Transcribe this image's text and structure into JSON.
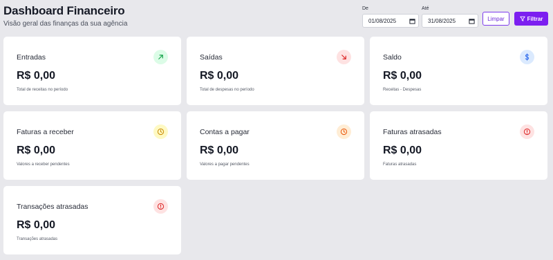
{
  "header": {
    "title": "Dashboard Financeiro",
    "subtitle": "Visão geral das finanças da sua agência"
  },
  "filters": {
    "from_label": "De",
    "from_value": "01/08/2025",
    "to_label": "Até",
    "to_value": "31/08/2025",
    "clear_label": "Limpar",
    "filter_label": "Filtrar"
  },
  "cards": [
    {
      "label": "Entradas",
      "value": "R$ 0,00",
      "note": "Total de receitas no período",
      "icon": "arrow-up-right-icon",
      "icon_bg": "#dcfce7",
      "icon_color": "#16a34a"
    },
    {
      "label": "Saídas",
      "value": "R$ 0,00",
      "note": "Total de despesas no período",
      "icon": "arrow-down-right-icon",
      "icon_bg": "#fee2e2",
      "icon_color": "#dc2626"
    },
    {
      "label": "Saldo",
      "value": "R$ 0,00",
      "note": "Receitas - Despesas",
      "icon": "dollar-icon",
      "icon_bg": "#dbeafe",
      "icon_color": "#2563eb"
    },
    {
      "label": "Faturas a receber",
      "value": "R$ 0,00",
      "note": "Valores a receber pendentes",
      "icon": "clock-icon",
      "icon_bg": "#fef9c3",
      "icon_color": "#ca8a04"
    },
    {
      "label": "Contas a pagar",
      "value": "R$ 0,00",
      "note": "Valores a pagar pendentes",
      "icon": "clock-icon",
      "icon_bg": "#ffedd5",
      "icon_color": "#ea580c"
    },
    {
      "label": "Faturas atrasadas",
      "value": "R$ 0,00",
      "note": "Faturas atrasadas",
      "icon": "alert-circle-icon",
      "icon_bg": "#fee2e2",
      "icon_color": "#dc2626"
    },
    {
      "label": "Transações atrasadas",
      "value": "R$ 0,00",
      "note": "Transações atrasadas",
      "icon": "alert-circle-icon",
      "icon_bg": "#fee2e2",
      "icon_color": "#dc2626"
    }
  ]
}
